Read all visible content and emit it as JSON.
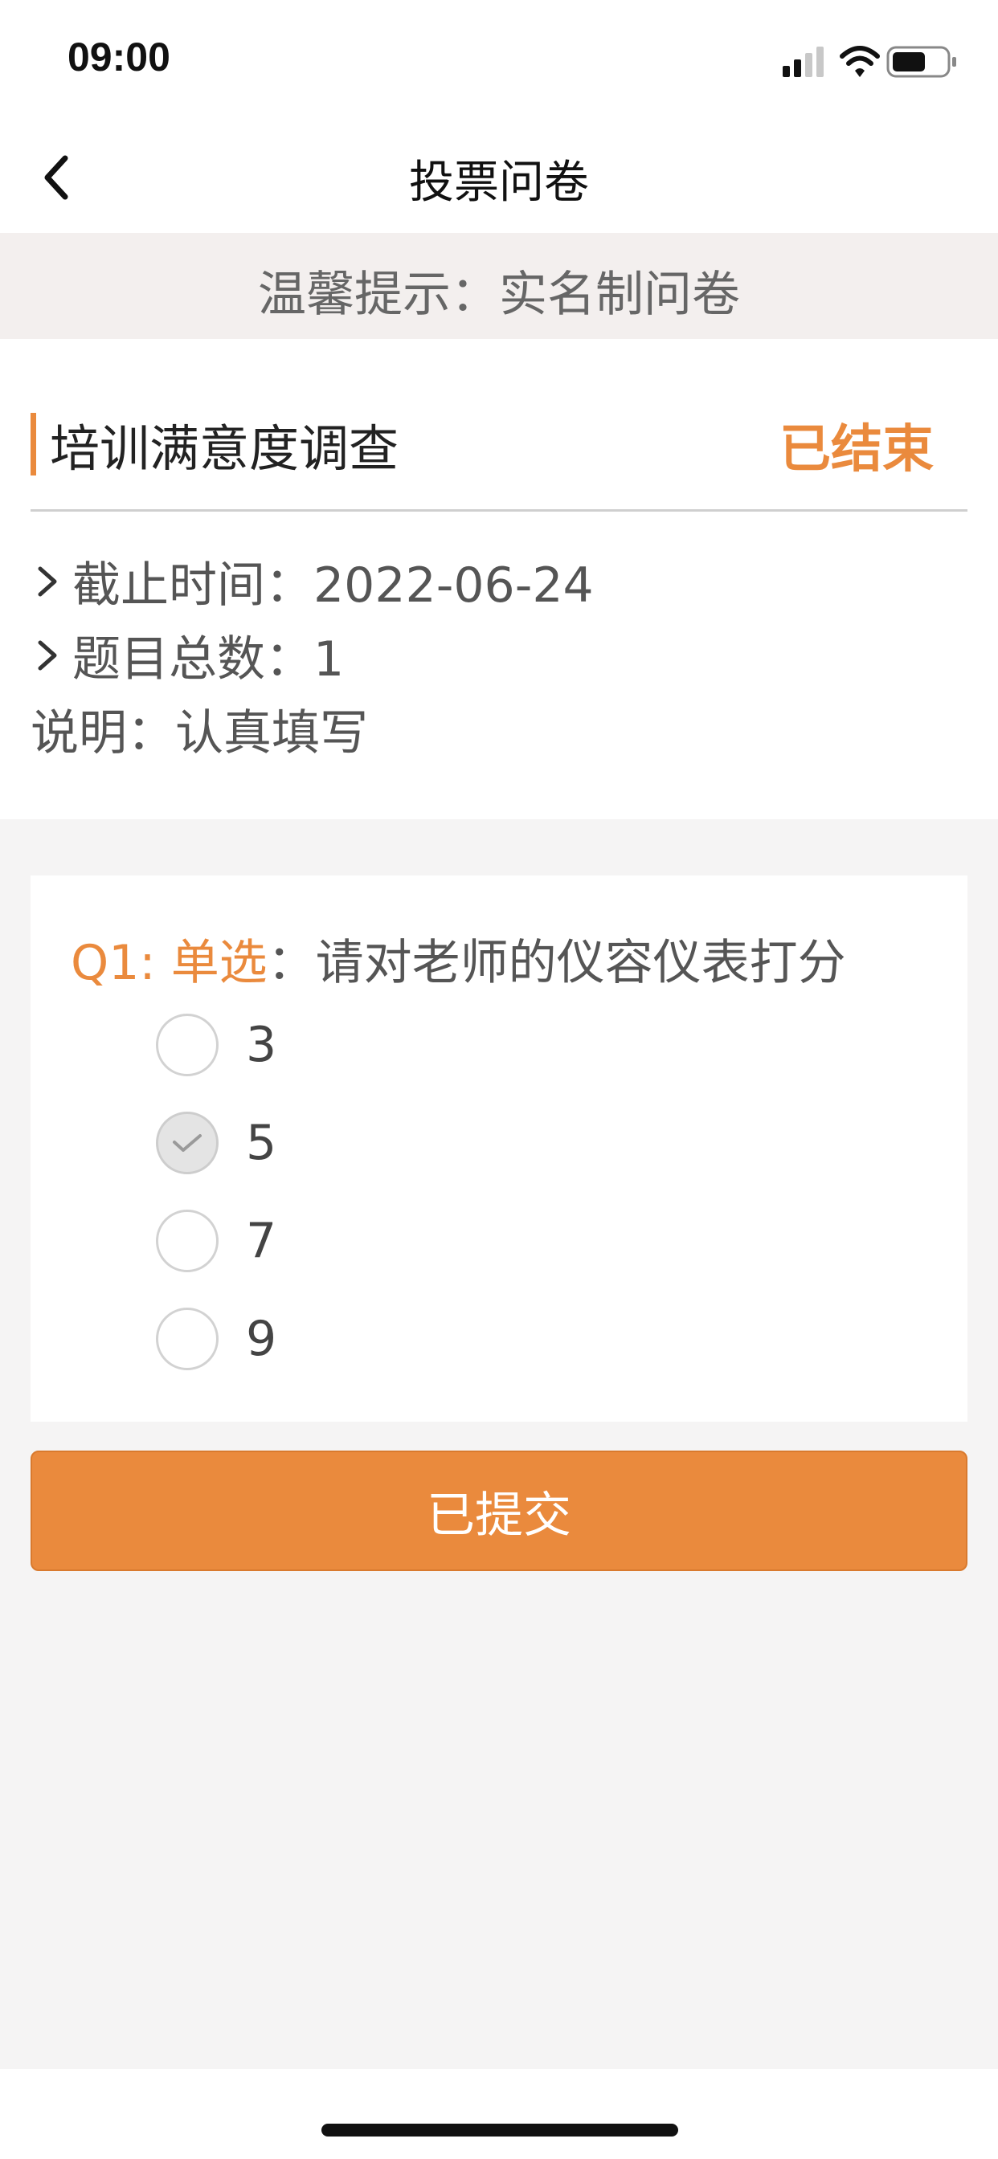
{
  "status_bar": {
    "time": "09:00",
    "icons": [
      "signal-icon",
      "wifi-icon",
      "battery-icon"
    ]
  },
  "nav": {
    "title": "投票问卷",
    "back_icon": "chevron-left-icon"
  },
  "tip": {
    "text": "温馨提示：实名制问卷"
  },
  "survey": {
    "title": "培训满意度调查",
    "status": "已结束",
    "deadline_label": "截止时间：2022-06-24",
    "count_label": "题目总数：1",
    "description_label": "说明：认真填写"
  },
  "question": {
    "prefix": "Q1: 单选",
    "text": "：请对老师的仪容仪表打分",
    "options": [
      {
        "label": "3",
        "checked": false
      },
      {
        "label": "5",
        "checked": true
      },
      {
        "label": "7",
        "checked": false
      },
      {
        "label": "9",
        "checked": false
      }
    ]
  },
  "submit": {
    "label": "已提交"
  },
  "colors": {
    "accent": "#ea8a3d",
    "background": "#f5f4f4",
    "tip_background": "#f3efee"
  }
}
